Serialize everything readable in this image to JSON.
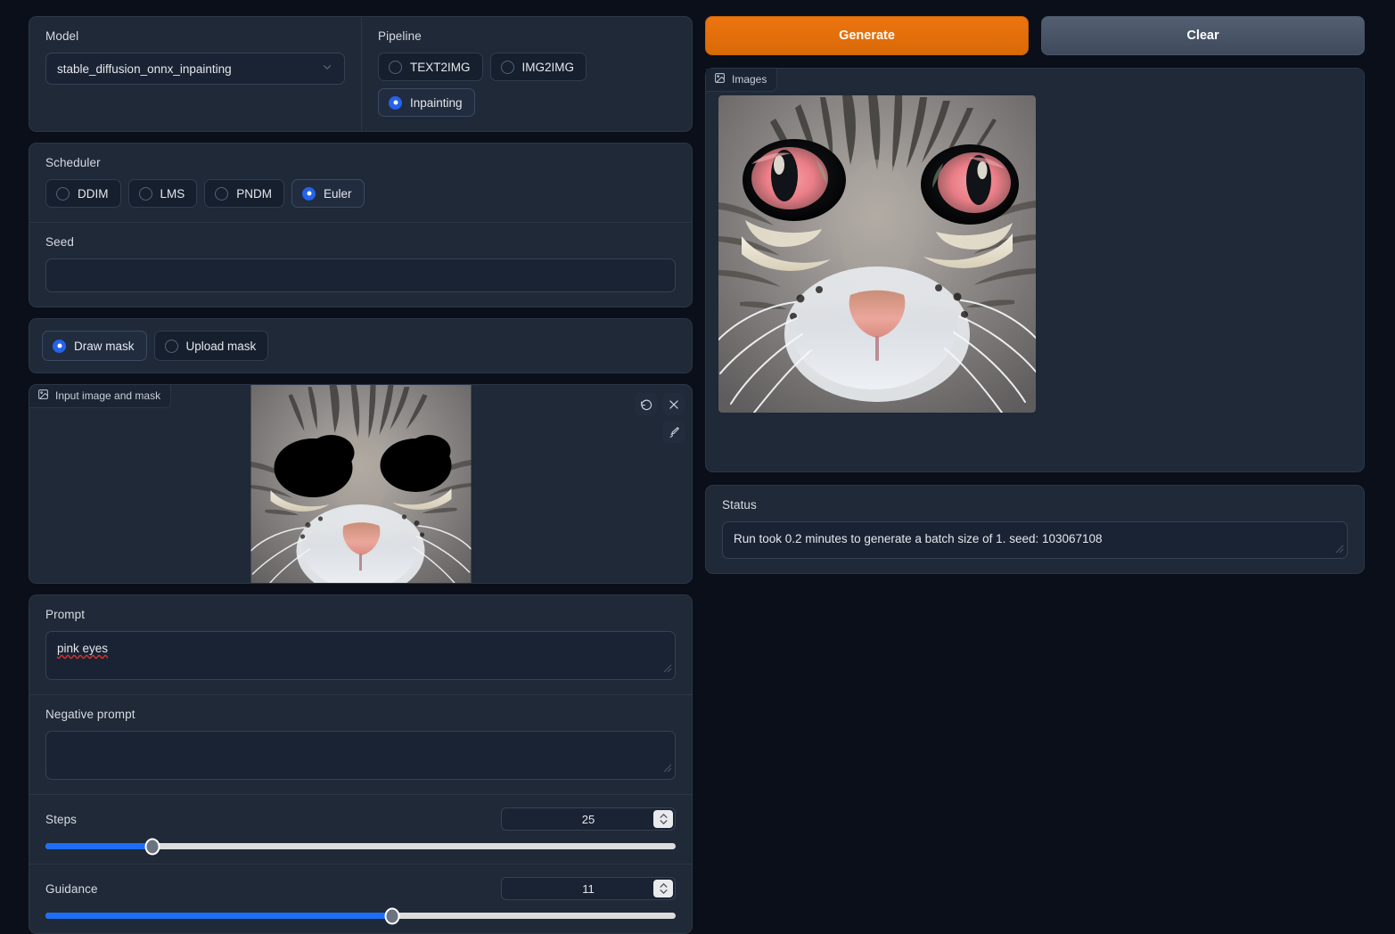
{
  "model": {
    "label": "Model",
    "value": "stable_diffusion_onnx_inpainting"
  },
  "pipeline": {
    "label": "Pipeline",
    "options": [
      {
        "label": "TEXT2IMG",
        "selected": false
      },
      {
        "label": "IMG2IMG",
        "selected": false
      },
      {
        "label": "Inpainting",
        "selected": true
      }
    ]
  },
  "scheduler": {
    "label": "Scheduler",
    "options": [
      {
        "label": "DDIM",
        "selected": false
      },
      {
        "label": "LMS",
        "selected": false
      },
      {
        "label": "PNDM",
        "selected": false
      },
      {
        "label": "Euler",
        "selected": true
      }
    ]
  },
  "seed": {
    "label": "Seed",
    "value": "",
    "placeholder": ""
  },
  "mask_mode": {
    "options": [
      {
        "label": "Draw mask",
        "selected": true
      },
      {
        "label": "Upload mask",
        "selected": false
      }
    ]
  },
  "input_canvas": {
    "tag": "Input image and mask",
    "tag_icon": "image-icon",
    "tools": [
      {
        "name": "undo-icon"
      },
      {
        "name": "close-icon"
      },
      {
        "name": "brush-icon"
      }
    ]
  },
  "prompt": {
    "label": "Prompt",
    "value": "pink eyes",
    "spellcheck_error": true
  },
  "negative_prompt": {
    "label": "Negative prompt",
    "value": ""
  },
  "steps": {
    "label": "Steps",
    "value": "25",
    "percent": 17
  },
  "guidance": {
    "label": "Guidance",
    "value": "11",
    "percent": 55
  },
  "actions": {
    "generate": "Generate",
    "clear": "Clear"
  },
  "gallery": {
    "tag": "Images",
    "tag_icon": "image-icon"
  },
  "status": {
    "label": "Status",
    "text": "Run took 0.2 minutes to generate a batch size of 1. seed: 103067108"
  },
  "colors": {
    "page_bg": "#0b0f19",
    "panel_bg": "#1f2937",
    "input_bg": "#1a2334",
    "accent_blue": "#2563eb",
    "slider_blue": "#1d6ef5",
    "generate_orange": "#ed7410",
    "clear_gray": "#4b5666",
    "spell_red": "#e2312b"
  }
}
